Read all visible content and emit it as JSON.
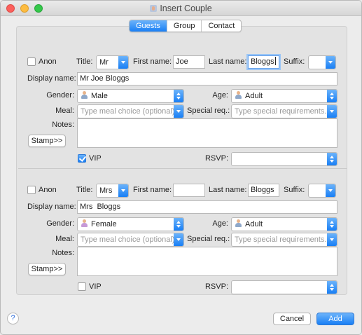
{
  "window": {
    "title": "Insert Couple"
  },
  "tabs": [
    {
      "label": "Guests",
      "active": true
    },
    {
      "label": "Group",
      "active": false
    },
    {
      "label": "Contact",
      "active": false
    }
  ],
  "labels": {
    "anon": "Anon",
    "title": "Title:",
    "first_name": "First name:",
    "last_name": "Last name:",
    "suffix": "Suffix:",
    "display_name": "Display name:",
    "gender": "Gender:",
    "age": "Age:",
    "meal": "Meal:",
    "special_req": "Special req.:",
    "notes": "Notes:",
    "stamp": "Stamp>>",
    "vip": "VIP",
    "rsvp": "RSVP:"
  },
  "placeholders": {
    "meal": "Type meal choice (optional)",
    "special_req": "Type special requirements..."
  },
  "guests": [
    {
      "anon": false,
      "title": "Mr",
      "first_name": "Joe",
      "last_name": "Bloggs",
      "suffix": "",
      "display_name": "Mr Joe Bloggs",
      "gender": "Male",
      "age": "Adult",
      "meal": "",
      "special_req": "",
      "notes": "",
      "vip": true,
      "rsvp": ""
    },
    {
      "anon": false,
      "title": "Mrs",
      "first_name": "",
      "last_name": "Bloggs",
      "suffix": "",
      "display_name": "Mrs  Bloggs",
      "gender": "Female",
      "age": "Adult",
      "meal": "",
      "special_req": "",
      "notes": "",
      "vip": false,
      "rsvp": ""
    }
  ],
  "footer": {
    "help": "?",
    "cancel": "Cancel",
    "add": "Add"
  },
  "colors": {
    "accent": "#197ff5",
    "close": "#fc605c",
    "minimize": "#fdbc40",
    "maximize": "#34c84a"
  }
}
